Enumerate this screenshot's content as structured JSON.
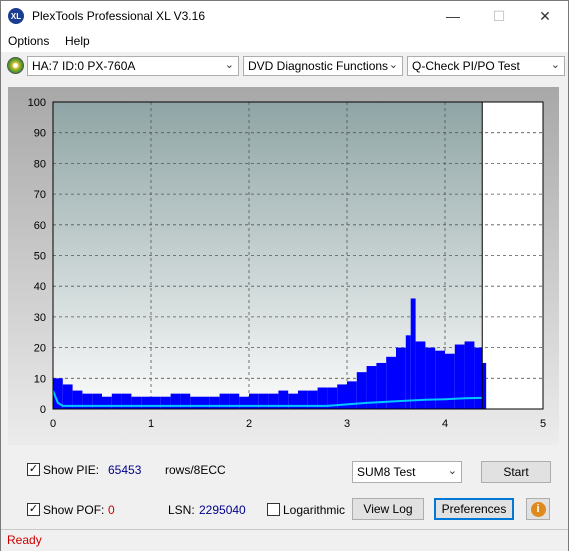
{
  "window": {
    "title": "PlexTools Professional XL V3.16",
    "icon_text": "XL"
  },
  "menu": {
    "options": "Options",
    "help": "Help"
  },
  "toolbar": {
    "drive": "HA:7 ID:0  PX-760A",
    "function": "DVD Diagnostic Functions",
    "test": "Q-Check PI/PO Test"
  },
  "chart_data": {
    "type": "bar",
    "x_ticks": [
      "0",
      "1",
      "2",
      "3",
      "4",
      "5"
    ],
    "y_ticks": [
      "0",
      "10",
      "20",
      "30",
      "40",
      "50",
      "60",
      "70",
      "80",
      "90",
      "100"
    ],
    "xlim": [
      0,
      5
    ],
    "ylim": [
      0,
      100
    ],
    "grid": true,
    "data_end_x": 4.38,
    "series": [
      {
        "color": "#0000ff",
        "x": [
          0.0,
          0.1,
          0.2,
          0.3,
          0.4,
          0.5,
          0.6,
          0.7,
          0.8,
          0.9,
          1.0,
          1.1,
          1.2,
          1.3,
          1.4,
          1.5,
          1.6,
          1.7,
          1.8,
          1.9,
          2.0,
          2.1,
          2.2,
          2.3,
          2.4,
          2.5,
          2.6,
          2.7,
          2.8,
          2.9,
          3.0,
          3.1,
          3.2,
          3.3,
          3.4,
          3.5,
          3.6,
          3.65,
          3.7,
          3.8,
          3.9,
          4.0,
          4.1,
          4.2,
          4.3,
          4.38
        ],
        "values": [
          10,
          8,
          6,
          5,
          5,
          4,
          5,
          5,
          4,
          4,
          4,
          4,
          5,
          5,
          4,
          4,
          4,
          5,
          5,
          4,
          5,
          5,
          5,
          6,
          5,
          6,
          6,
          7,
          7,
          8,
          9,
          12,
          14,
          15,
          17,
          20,
          24,
          36,
          22,
          20,
          19,
          18,
          21,
          22,
          20,
          15
        ]
      },
      {
        "color": "#00c8ff",
        "x": [
          0.0,
          0.05,
          0.1,
          0.3,
          0.6,
          1.0,
          1.5,
          2.0,
          2.5,
          2.8,
          3.0,
          3.2,
          3.5,
          3.8,
          4.0,
          4.2,
          4.38
        ],
        "values": [
          6,
          2,
          1,
          1,
          1,
          1,
          1,
          1,
          1,
          1,
          1.5,
          2,
          2.5,
          3,
          3.2,
          3.5,
          3.6
        ]
      }
    ]
  },
  "controls": {
    "show_pie_label": "Show PIE:",
    "pie_value": "65453",
    "pie_unit": "rows/8ECC",
    "show_pof_label": "Show POF:",
    "pof_value": "0",
    "lsn_label": "LSN:",
    "lsn_value": "2295040",
    "logarithmic_label": "Logarithmic",
    "test_select": "SUM8 Test",
    "start": "Start",
    "view_log": "View Log",
    "preferences": "Preferences",
    "show_pie_checked": true,
    "show_pof_checked": true,
    "logarithmic_checked": false
  },
  "status": {
    "text": "Ready"
  },
  "colors": {
    "pie_value": "#00008b",
    "pof_value": "#cc0000",
    "status": "#d00000"
  }
}
